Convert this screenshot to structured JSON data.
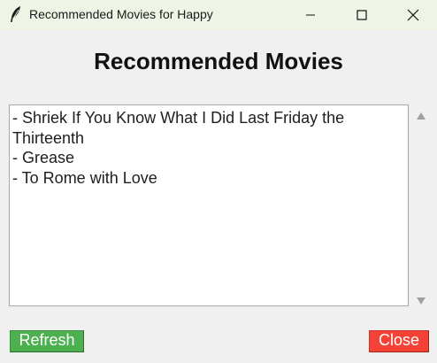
{
  "window": {
    "title": "Recommended Movies for Happy",
    "icon": "feather-icon",
    "controls": [
      "minimize-icon",
      "maximize-icon",
      "close-icon"
    ]
  },
  "main": {
    "heading": "Recommended Movies",
    "movies": [
      "- Shriek If You Know What I Did Last Friday the",
      "Thirteenth",
      "- Grease",
      "- To Rome with Love"
    ]
  },
  "buttons": {
    "refresh_label": "Refresh",
    "refresh_color": "#4caf50",
    "close_label": "Close",
    "close_color": "#f44336"
  },
  "colors": {
    "titlebar_bg": "#eef4e6",
    "window_bg": "#f0f0f0",
    "textbox_bg": "#ffffff"
  }
}
